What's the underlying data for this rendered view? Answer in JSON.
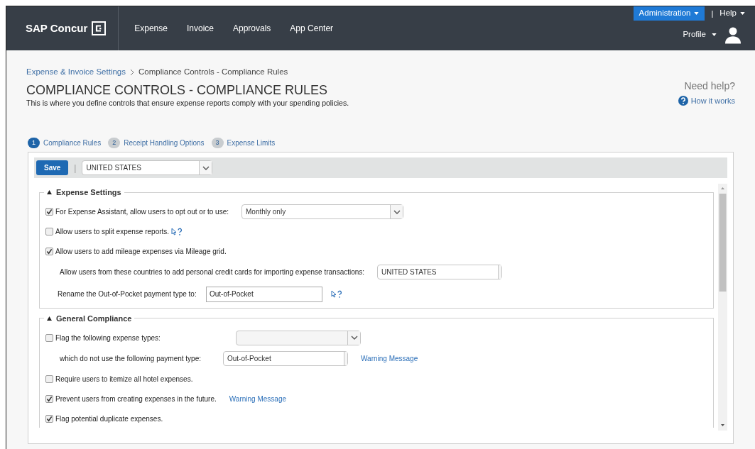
{
  "header": {
    "brand": "SAP Concur",
    "nav": [
      {
        "label": "Expense"
      },
      {
        "label": "Invoice"
      },
      {
        "label": "Approvals"
      },
      {
        "label": "App Center"
      }
    ],
    "admin": "Administration",
    "separator": "|",
    "help": "Help",
    "profile": "Profile"
  },
  "breadcrumb": {
    "parent": "Expense & Invoice Settings",
    "current": "Compliance Controls - Compliance Rules"
  },
  "title": "COMPLIANCE CONTROLS - COMPLIANCE RULES",
  "description": "This is where you define controls that ensure expense reports comply with your spending policies.",
  "help_box": {
    "heading": "Need help?",
    "link": "How it works"
  },
  "steps": [
    {
      "number": "1",
      "label": "Compliance Rules",
      "selected": true
    },
    {
      "number": "2",
      "label": "Receipt Handling Options",
      "selected": false
    },
    {
      "number": "3",
      "label": "Expense Limits",
      "selected": false
    }
  ],
  "toolbar": {
    "save": "Save",
    "separator": "|",
    "country": "UNITED STATES"
  },
  "sections": [
    {
      "title": "Expense Settings",
      "expanded": true,
      "rows": [
        {
          "kind": "checkbox",
          "label": "For Expense Assistant, allow users to opt out or to use:",
          "checked": true,
          "select": {
            "value": "Monthly only"
          }
        },
        {
          "kind": "checkbox",
          "label": "Allow users to split expense reports.",
          "checked": false,
          "help": true
        },
        {
          "kind": "checkbox",
          "label": "Allow users to add mileage expenses via Mileage grid.",
          "checked": true
        },
        {
          "kind": "select",
          "label": "Allow users from these countries to add personal credit cards for importing expense transactions:",
          "select": {
            "value": "UNITED STATES"
          }
        },
        {
          "kind": "input",
          "label": "Rename the Out-of-Pocket payment type to:",
          "value": "Out-of-Pocket",
          "help": true
        }
      ]
    },
    {
      "title": "General Compliance",
      "expanded": true,
      "rows": [
        {
          "kind": "checkbox",
          "label": "Flag the following expense types:",
          "checked": false,
          "select": {
            "empty": true
          }
        },
        {
          "kind": "select",
          "label": "which do not use the following payment type:",
          "select": {
            "value": "Out-of-Pocket"
          },
          "link": "Warning Message"
        },
        {
          "kind": "checkbox",
          "label": "Require users to itemize all hotel expenses.",
          "checked": false
        },
        {
          "kind": "checkbox",
          "label": "Prevent users from creating expenses in the future.",
          "checked": true,
          "link": "Warning Message"
        },
        {
          "kind": "checkbox",
          "label": "Flag potential duplicate expenses.",
          "checked": true
        }
      ]
    }
  ]
}
